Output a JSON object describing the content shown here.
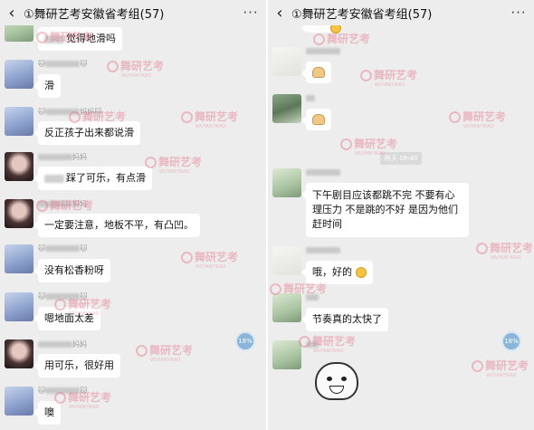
{
  "left": {
    "header": {
      "back_icon": "chevron-left-icon",
      "title": "①舞研艺考安徽省考组(57)",
      "more_icon": "more-icon",
      "more_glyph": "···"
    },
    "messages": [
      {
        "text": "觉得地滑吗"
      },
      {
        "name_suffix": "",
        "text": "滑"
      },
      {
        "name_suffix": "妈妈",
        "text": "反正孩子出来都说滑"
      },
      {
        "name_suffix": "妈妈",
        "text": "踩了可乐，有点滑"
      },
      {
        "name_suffix": "妈妈",
        "text": "一定要注意，地板不平，有凸凹。"
      },
      {
        "name_suffix": "",
        "text": "没有松香粉呀"
      },
      {
        "name_suffix": "",
        "text": "嗯地面太差"
      },
      {
        "name_suffix": "妈妈",
        "text": "用可乐，很好用"
      },
      {
        "name_suffix": "",
        "text": "噢"
      }
    ],
    "progress": "18%"
  },
  "right": {
    "header": {
      "back_icon": "chevron-left-icon",
      "title": "①舞研艺考安徽省考组(57)",
      "more_icon": "more-icon",
      "more_glyph": "···"
    },
    "time_chip": "昨天 09:40",
    "messages": [
      {
        "text": "下午剧目应该都跳不完 不要有心理压力 不是跳的不好 是因为他们赶时间"
      },
      {
        "text": "哦，好的"
      },
      {
        "text": "节奏真的太快了"
      }
    ],
    "progress": "18%"
  },
  "watermark": {
    "text": "舞研艺考",
    "sub": "WUYANYIKAO"
  },
  "colors": {
    "background": "#ededed",
    "bubble": "#ffffff",
    "watermark": "#e6788c",
    "progress": "#8ab5d9"
  }
}
